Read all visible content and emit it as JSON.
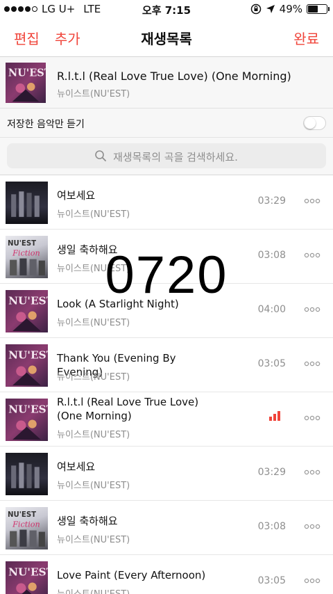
{
  "status": {
    "carrier": "LG U+",
    "network": "LTE",
    "time": "오후 7:15",
    "battery": "49%",
    "battery_level": 0.49
  },
  "nav": {
    "edit": "편집",
    "add": "추가",
    "title": "재생목록",
    "done": "완료"
  },
  "now_playing": {
    "title": "R.l.t.l (Real Love True Love) (One Morning)",
    "artist": "뉴이스트(NU'EST)"
  },
  "filter": {
    "label": "저장한 음악만 듣기",
    "enabled": false
  },
  "search": {
    "placeholder": "재생목록의 곡을 검색하세요."
  },
  "overlay_text": "0720",
  "tracks": [
    {
      "title": "여보세요",
      "artist": "뉴이스트(NU'EST)",
      "duration": "03:29"
    },
    {
      "title": "생일 축하해요",
      "artist": "뉴이스트(NU'EST)",
      "duration": "03:08"
    },
    {
      "title": "Look (A Starlight Night)",
      "artist": "뉴이스트(NU'EST)",
      "duration": "04:00"
    },
    {
      "title": "Thank You (Evening By Evening)",
      "artist": "뉴이스트(NU'EST)",
      "duration": "03:05"
    },
    {
      "title": "R.l.t.l (Real Love True Love) (One Morning)",
      "artist": "뉴이스트(NU'EST)",
      "duration": "",
      "playing": true
    },
    {
      "title": "여보세요",
      "artist": "뉴이스트(NU'EST)",
      "duration": "03:29"
    },
    {
      "title": "생일 축하해요",
      "artist": "뉴이스트(NU'EST)",
      "duration": "03:08"
    },
    {
      "title": "Love Paint (Every Afternoon)",
      "artist": "뉴이스트(NU'EST)",
      "duration": "03:05"
    }
  ],
  "colors": {
    "accent": "#f0443a",
    "secondary_text": "#8e8e8e"
  }
}
